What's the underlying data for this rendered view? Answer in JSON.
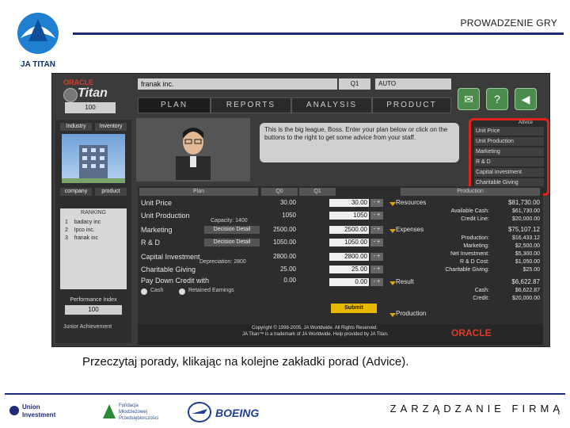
{
  "slide": {
    "title": "PROWADZENIE GRY",
    "logo_text": "JA TITAN",
    "caption": "Przeczytaj porady, klikając na kolejne zakładki porad (Advice).",
    "footer_title": "ZARZĄDZANIE FIRMĄ",
    "sponsors": {
      "union": "Union Investment",
      "fundacja_lines": [
        "Fundacja",
        "Młodzieżowej",
        "Przedsiębiorczości"
      ],
      "boeing": "BOEING"
    }
  },
  "app": {
    "brand_oracle": "ORACLE",
    "brand_titan": "Titan",
    "company": "franak inc.",
    "quarter": "Q1",
    "mode": "AUTO",
    "year": "100",
    "tabs": [
      "PLAN",
      "REPORTS",
      "ANALYSIS",
      "PRODUCT"
    ],
    "left": {
      "industry": "Industry",
      "inventory": "Inventory",
      "company": "company",
      "product": "product",
      "ranking_title": "RANKING",
      "ranking": [
        {
          "rank": "1",
          "name": "badacy inc"
        },
        {
          "rank": "2",
          "name": "Ipco inc."
        },
        {
          "rank": "3",
          "name": "franak inc"
        }
      ],
      "perf_label": "Performance Index",
      "perf_value": "100",
      "ja_footer": "Junior Achievement"
    },
    "advice": {
      "bubble": "This is the big league, Boss. Enter your plan below or click on the buttons to the right to get some advice from your staff.",
      "title": "Advice",
      "tabs": [
        "Unit Price",
        "Unit Production",
        "Marketing",
        "R & D",
        "Capital Investment",
        "Charitable Giving"
      ]
    },
    "table": {
      "headers": {
        "plan": "Plan",
        "q": "Q0",
        "q1": "Q1",
        "prod": "Production"
      },
      "rows": [
        {
          "label": "Unit Price",
          "q": "30.00",
          "q1": "",
          "input": "30.00"
        },
        {
          "label": "Unit Production",
          "q": "1050",
          "q1": "",
          "input": "1050"
        },
        {
          "label": "Marketing",
          "q": "2500.00",
          "q1": "",
          "input": "2500.00"
        },
        {
          "label": "R & D",
          "q": "1050.00",
          "q1": "",
          "input": "1050.00"
        },
        {
          "label": "Capital Investment",
          "q": "2800.00",
          "q1": "",
          "input": "2800.00"
        },
        {
          "label": "Charitable Giving",
          "q": "25.00",
          "q1": "",
          "input": "25.00"
        },
        {
          "label": "Pay Down Credit with",
          "q": "0.00",
          "q1": "",
          "input": "0.00"
        }
      ],
      "capacity_label": "Capacity: 1400",
      "depreciation_label": "Depreciation: 2800",
      "decision_btn": "Decision Detail",
      "radio_cash": "Cash",
      "radio_retained": "Retained Earnings",
      "submit": "Submit"
    },
    "summary": {
      "resources_label": "Resources",
      "resources_total": "$81,730.00",
      "resources_rows": [
        {
          "label": "Available Cash:",
          "value": "$61,730.00"
        },
        {
          "label": "Credit Line:",
          "value": "$20,000.00"
        }
      ],
      "expenses_label": "Expenses",
      "expenses_total": "$75,107.12",
      "expenses_rows": [
        {
          "label": "Production:",
          "value": "$16,433.12"
        },
        {
          "label": "Marketing:",
          "value": "$2,500.00"
        },
        {
          "label": "Net Investment:",
          "value": "$5,300.00"
        },
        {
          "label": "R & D Cost:",
          "value": "$1,050.00"
        },
        {
          "label": "Charitable Giving:",
          "value": "$25.00"
        }
      ],
      "result_label": "Result",
      "result_total": "$6,622.87",
      "result_rows": [
        {
          "label": "Cash:",
          "value": "$6,622.87"
        },
        {
          "label": "Credit:",
          "value": "$20,000.00"
        }
      ],
      "production_label": "Production"
    },
    "copyright_1": "Copyright © 1998-2005, JA Worldwide. All Rights Reserved.",
    "copyright_2": "JA Titan™ is a trademark of JA Worldwide. Help provided by JA Titan.",
    "oracle_footer": "ORACLE"
  }
}
